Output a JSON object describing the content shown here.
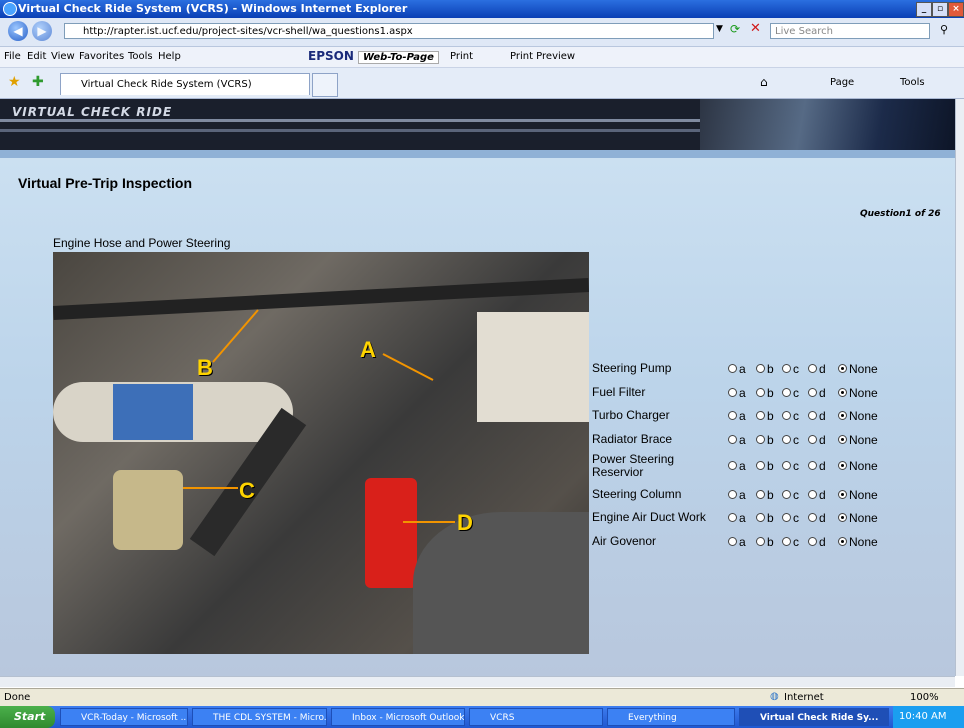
{
  "window": {
    "title": "Virtual Check Ride System (VCRS) - Windows Internet Explorer"
  },
  "addressbar": {
    "url": "http://rapter.ist.ucf.edu/project-sites/vcr-shell/wa_questions1.aspx",
    "search_placeholder": "Live Search"
  },
  "menu": {
    "items": [
      "File",
      "Edit",
      "View",
      "Favorites",
      "Tools",
      "Help"
    ],
    "epson": "EPSON",
    "web_to_page": "Web-To-Page",
    "print": "Print",
    "print_preview": "Print Preview"
  },
  "favbar": {
    "tab_label": "Virtual Check Ride System (VCRS)",
    "page_label": "Page",
    "tools_label": "Tools"
  },
  "page": {
    "banner_logo": "VIRTUAL CHECK RIDE",
    "heading": "Virtual Pre-Trip Inspection",
    "question_counter": "Question1 of 26",
    "image_title": "Engine Hose and Power Steering",
    "markers": [
      "A",
      "B",
      "C",
      "D"
    ],
    "option_labels": [
      "a",
      "b",
      "c",
      "d",
      "None"
    ],
    "questions": [
      {
        "label": "Steering Pump",
        "selected": "None"
      },
      {
        "label": "Fuel Filter",
        "selected": "None"
      },
      {
        "label": "Turbo Charger",
        "selected": "None"
      },
      {
        "label": "Radiator Brace",
        "selected": "None"
      },
      {
        "label": "Power Steering Reservior",
        "selected": "None"
      },
      {
        "label": "Steering Column",
        "selected": "None"
      },
      {
        "label": "Engine Air Duct Work",
        "selected": "None"
      },
      {
        "label": "Air Govenor",
        "selected": "None"
      }
    ]
  },
  "status": {
    "text": "Done",
    "zone": "Internet",
    "zoom": "100%"
  },
  "taskbar": {
    "start": "Start",
    "tasks": [
      "VCR-Today - Microsoft ...",
      "THE CDL SYSTEM - Micro...",
      "Inbox - Microsoft Outlook",
      "VCRS",
      "Everything",
      "Virtual Check Ride Sy..."
    ],
    "clock": "10:40 AM"
  }
}
